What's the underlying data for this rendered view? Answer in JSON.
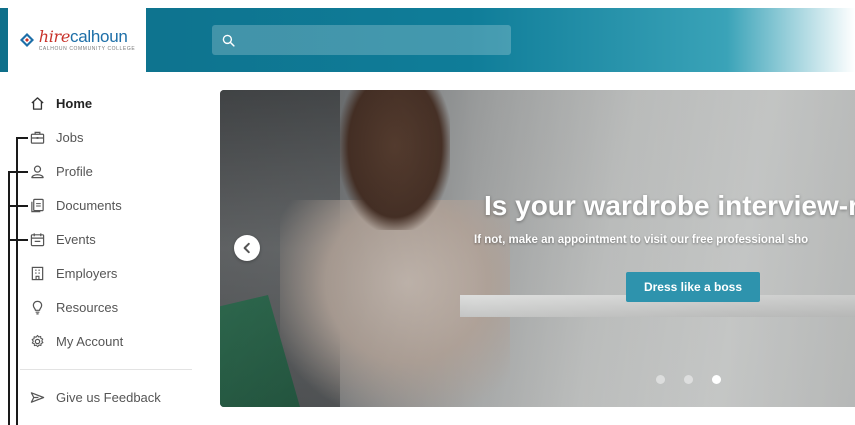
{
  "app": {
    "logo": {
      "hire": "hire",
      "calhoun": "calhoun",
      "subtitle": "CALHOUN COMMUNITY COLLEGE"
    },
    "search": {
      "placeholder": "",
      "value": ""
    },
    "colors": {
      "header": "#0f7d99",
      "accent": "#2e93ad"
    }
  },
  "sidebar": {
    "items": [
      {
        "label": "Home",
        "icon": "home-icon",
        "active": true
      },
      {
        "label": "Jobs",
        "icon": "briefcase-icon",
        "active": false
      },
      {
        "label": "Profile",
        "icon": "user-icon",
        "active": false
      },
      {
        "label": "Documents",
        "icon": "documents-icon",
        "active": false
      },
      {
        "label": "Events",
        "icon": "calendar-icon",
        "active": false
      },
      {
        "label": "Employers",
        "icon": "building-icon",
        "active": false
      },
      {
        "label": "Resources",
        "icon": "lightbulb-icon",
        "active": false
      },
      {
        "label": "My Account",
        "icon": "gear-icon",
        "active": false
      }
    ],
    "feedback": {
      "label": "Give us Feedback",
      "icon": "send-icon"
    }
  },
  "carousel": {
    "title": "Is your wardrobe interview-rea",
    "subtitle": "If not, make an appointment to visit our free professional sho",
    "button_label": "Dress like a boss",
    "slide_count": 3,
    "active_slide": 3
  }
}
